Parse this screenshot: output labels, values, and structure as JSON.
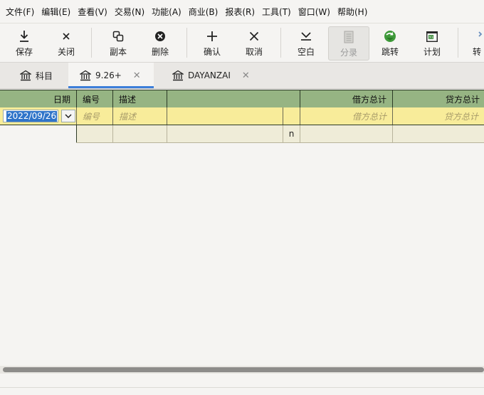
{
  "menu": [
    "文件(F)",
    "编辑(E)",
    "查看(V)",
    "交易(N)",
    "功能(A)",
    "商业(B)",
    "报表(R)",
    "工具(T)",
    "窗口(W)",
    "帮助(H)"
  ],
  "toolbar": {
    "save": "保存",
    "close": "关闭",
    "duplicate": "副本",
    "delete": "删除",
    "enter": "确认",
    "cancel": "取消",
    "blank": "空白",
    "split": "分录",
    "jump": "跳转",
    "schedule": "计划",
    "transfer": "转"
  },
  "tabs": [
    {
      "label": "科目",
      "active": false
    },
    {
      "label": "9.26+",
      "active": true
    },
    {
      "label": "DAYANZAI",
      "active": false
    }
  ],
  "register": {
    "headers": {
      "date": "日期",
      "num": "编号",
      "description": "描述",
      "transfer": "",
      "debit_total": "借方总计",
      "credit_total": "贷方总计"
    },
    "entry": {
      "date": "2022/09/26",
      "num_placeholder": "编号",
      "description_placeholder": "描述",
      "debit_placeholder": "借方总计",
      "credit_placeholder": "贷方总计"
    },
    "split_row": {
      "reconcile": "n"
    }
  },
  "colors": {
    "header_bg": "#96b483",
    "entry_row_bg": "#f8ec9a",
    "split_row_bg": "#efecd8",
    "selection": "#2f74c9",
    "tab_accent": "#3d7fd9"
  }
}
